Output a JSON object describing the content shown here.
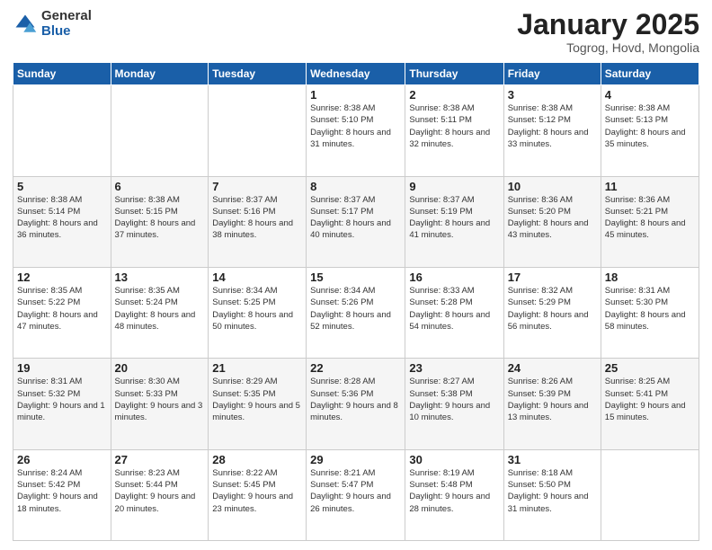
{
  "logo": {
    "general": "General",
    "blue": "Blue"
  },
  "header": {
    "month": "January 2025",
    "location": "Togrog, Hovd, Mongolia"
  },
  "weekdays": [
    "Sunday",
    "Monday",
    "Tuesday",
    "Wednesday",
    "Thursday",
    "Friday",
    "Saturday"
  ],
  "weeks": [
    [
      {
        "day": "",
        "info": ""
      },
      {
        "day": "",
        "info": ""
      },
      {
        "day": "",
        "info": ""
      },
      {
        "day": "1",
        "info": "Sunrise: 8:38 AM\nSunset: 5:10 PM\nDaylight: 8 hours\nand 31 minutes."
      },
      {
        "day": "2",
        "info": "Sunrise: 8:38 AM\nSunset: 5:11 PM\nDaylight: 8 hours\nand 32 minutes."
      },
      {
        "day": "3",
        "info": "Sunrise: 8:38 AM\nSunset: 5:12 PM\nDaylight: 8 hours\nand 33 minutes."
      },
      {
        "day": "4",
        "info": "Sunrise: 8:38 AM\nSunset: 5:13 PM\nDaylight: 8 hours\nand 35 minutes."
      }
    ],
    [
      {
        "day": "5",
        "info": "Sunrise: 8:38 AM\nSunset: 5:14 PM\nDaylight: 8 hours\nand 36 minutes."
      },
      {
        "day": "6",
        "info": "Sunrise: 8:38 AM\nSunset: 5:15 PM\nDaylight: 8 hours\nand 37 minutes."
      },
      {
        "day": "7",
        "info": "Sunrise: 8:37 AM\nSunset: 5:16 PM\nDaylight: 8 hours\nand 38 minutes."
      },
      {
        "day": "8",
        "info": "Sunrise: 8:37 AM\nSunset: 5:17 PM\nDaylight: 8 hours\nand 40 minutes."
      },
      {
        "day": "9",
        "info": "Sunrise: 8:37 AM\nSunset: 5:19 PM\nDaylight: 8 hours\nand 41 minutes."
      },
      {
        "day": "10",
        "info": "Sunrise: 8:36 AM\nSunset: 5:20 PM\nDaylight: 8 hours\nand 43 minutes."
      },
      {
        "day": "11",
        "info": "Sunrise: 8:36 AM\nSunset: 5:21 PM\nDaylight: 8 hours\nand 45 minutes."
      }
    ],
    [
      {
        "day": "12",
        "info": "Sunrise: 8:35 AM\nSunset: 5:22 PM\nDaylight: 8 hours\nand 47 minutes."
      },
      {
        "day": "13",
        "info": "Sunrise: 8:35 AM\nSunset: 5:24 PM\nDaylight: 8 hours\nand 48 minutes."
      },
      {
        "day": "14",
        "info": "Sunrise: 8:34 AM\nSunset: 5:25 PM\nDaylight: 8 hours\nand 50 minutes."
      },
      {
        "day": "15",
        "info": "Sunrise: 8:34 AM\nSunset: 5:26 PM\nDaylight: 8 hours\nand 52 minutes."
      },
      {
        "day": "16",
        "info": "Sunrise: 8:33 AM\nSunset: 5:28 PM\nDaylight: 8 hours\nand 54 minutes."
      },
      {
        "day": "17",
        "info": "Sunrise: 8:32 AM\nSunset: 5:29 PM\nDaylight: 8 hours\nand 56 minutes."
      },
      {
        "day": "18",
        "info": "Sunrise: 8:31 AM\nSunset: 5:30 PM\nDaylight: 8 hours\nand 58 minutes."
      }
    ],
    [
      {
        "day": "19",
        "info": "Sunrise: 8:31 AM\nSunset: 5:32 PM\nDaylight: 9 hours\nand 1 minute."
      },
      {
        "day": "20",
        "info": "Sunrise: 8:30 AM\nSunset: 5:33 PM\nDaylight: 9 hours\nand 3 minutes."
      },
      {
        "day": "21",
        "info": "Sunrise: 8:29 AM\nSunset: 5:35 PM\nDaylight: 9 hours\nand 5 minutes."
      },
      {
        "day": "22",
        "info": "Sunrise: 8:28 AM\nSunset: 5:36 PM\nDaylight: 9 hours\nand 8 minutes."
      },
      {
        "day": "23",
        "info": "Sunrise: 8:27 AM\nSunset: 5:38 PM\nDaylight: 9 hours\nand 10 minutes."
      },
      {
        "day": "24",
        "info": "Sunrise: 8:26 AM\nSunset: 5:39 PM\nDaylight: 9 hours\nand 13 minutes."
      },
      {
        "day": "25",
        "info": "Sunrise: 8:25 AM\nSunset: 5:41 PM\nDaylight: 9 hours\nand 15 minutes."
      }
    ],
    [
      {
        "day": "26",
        "info": "Sunrise: 8:24 AM\nSunset: 5:42 PM\nDaylight: 9 hours\nand 18 minutes."
      },
      {
        "day": "27",
        "info": "Sunrise: 8:23 AM\nSunset: 5:44 PM\nDaylight: 9 hours\nand 20 minutes."
      },
      {
        "day": "28",
        "info": "Sunrise: 8:22 AM\nSunset: 5:45 PM\nDaylight: 9 hours\nand 23 minutes."
      },
      {
        "day": "29",
        "info": "Sunrise: 8:21 AM\nSunset: 5:47 PM\nDaylight: 9 hours\nand 26 minutes."
      },
      {
        "day": "30",
        "info": "Sunrise: 8:19 AM\nSunset: 5:48 PM\nDaylight: 9 hours\nand 28 minutes."
      },
      {
        "day": "31",
        "info": "Sunrise: 8:18 AM\nSunset: 5:50 PM\nDaylight: 9 hours\nand 31 minutes."
      },
      {
        "day": "",
        "info": ""
      }
    ]
  ]
}
